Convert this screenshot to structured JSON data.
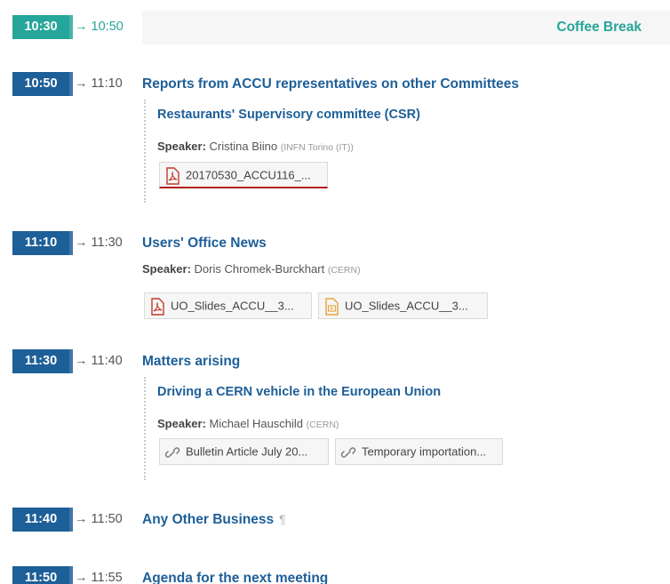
{
  "colors": {
    "accent_blue": "#1d5f98",
    "accent_teal": "#26a69a",
    "pdf_red": "#c0392b",
    "presentation_orange": "#e8a33d"
  },
  "arrow": "→",
  "entries": [
    {
      "start": "10:30",
      "end": "10:50",
      "title": "Coffee Break"
    },
    {
      "start": "10:50",
      "end": "11:10",
      "title": "Reports from ACCU representatives on other Committees",
      "sub": {
        "title": "Restaurants' Supervisory committee (CSR)",
        "speaker_label": "Speaker:",
        "speaker": "Cristina Biino",
        "affiliation": "(INFN Torino (IT))",
        "files": [
          {
            "icon": "pdf-icon",
            "label": "20170530_ACCU116_..."
          }
        ]
      }
    },
    {
      "start": "11:10",
      "end": "11:30",
      "title": "Users' Office News",
      "speaker_label": "Speaker:",
      "speaker": "Doris Chromek-Burckhart",
      "affiliation": "(CERN)",
      "files": [
        {
          "icon": "pdf-icon",
          "label": "UO_Slides_ACCU__3..."
        },
        {
          "icon": "presentation-icon",
          "label": "UO_Slides_ACCU__3..."
        }
      ]
    },
    {
      "start": "11:30",
      "end": "11:40",
      "title": "Matters arising",
      "sub": {
        "title": "Driving a CERN vehicle in the European Union",
        "speaker_label": "Speaker:",
        "speaker": "Michael Hauschild",
        "affiliation": "(CERN)",
        "links": [
          {
            "icon": "link-icon",
            "label": "Bulletin Article July 20..."
          },
          {
            "icon": "link-icon",
            "label": "Temporary importation..."
          }
        ]
      }
    },
    {
      "start": "11:40",
      "end": "11:50",
      "title": "Any Other Business",
      "pilcrow": "¶"
    },
    {
      "start": "11:50",
      "end": "11:55",
      "title": "Agenda for the next meeting"
    }
  ]
}
